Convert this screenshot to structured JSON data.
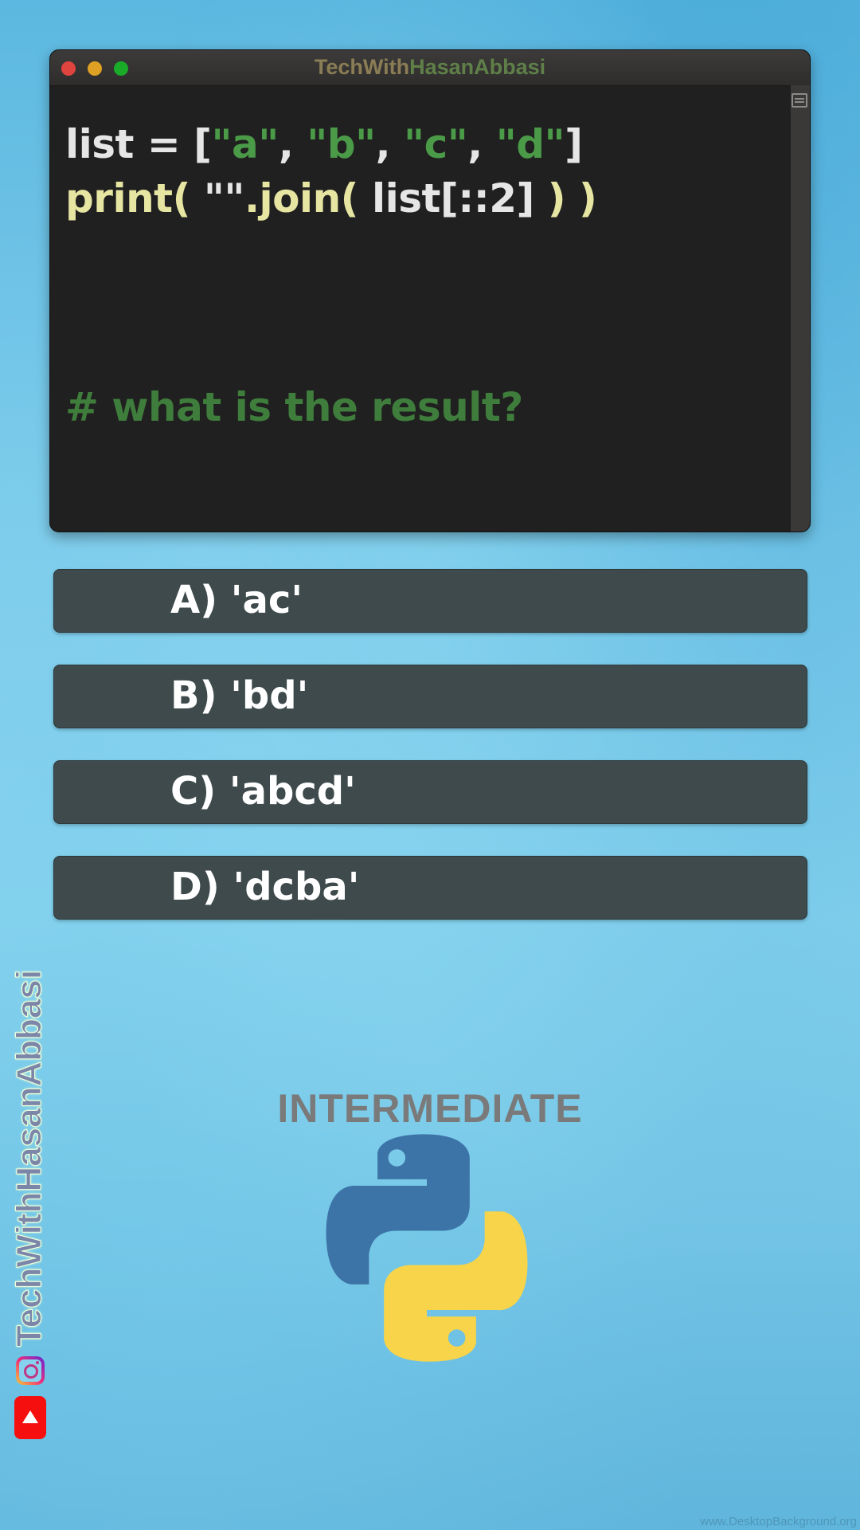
{
  "window": {
    "title_part1": "TechWith",
    "title_part2": "HasanAbbasi"
  },
  "code": {
    "line1": [
      {
        "text": "list = [",
        "color": "white"
      },
      {
        "text": "\"a\"",
        "color": "green"
      },
      {
        "text": ", ",
        "color": "white"
      },
      {
        "text": "\"b\"",
        "color": "green"
      },
      {
        "text": ", ",
        "color": "white"
      },
      {
        "text": "\"c\"",
        "color": "green"
      },
      {
        "text": ", ",
        "color": "white"
      },
      {
        "text": "\"d\"",
        "color": "green"
      },
      {
        "text": "]",
        "color": "white"
      }
    ],
    "line2": [
      {
        "text": "print( ",
        "color": "yellow"
      },
      {
        "text": "\"\"",
        "color": "white"
      },
      {
        "text": ".join( ",
        "color": "yellow"
      },
      {
        "text": "list[::2] ",
        "color": "white"
      },
      {
        "text": ") )",
        "color": "yellow"
      }
    ],
    "comment": "# what is the result?"
  },
  "options": [
    {
      "label": "A) 'ac'"
    },
    {
      "label": "B) 'bd'"
    },
    {
      "label": "C) 'abcd'"
    },
    {
      "label": "D) 'dcba'"
    }
  ],
  "level": "INTERMEDIATE",
  "branding": {
    "side_text": "TechWithHasanAbbasi",
    "icons": [
      "instagram-icon",
      "youtube-icon"
    ]
  },
  "watermark": "www.DesktopBackground.org",
  "colors": {
    "code_white": "#e6e6e6",
    "code_green": "#4a9a48",
    "code_yellow": "#e7e5a2",
    "option_bg": "#3e4a4b",
    "python_blue": "#3d74a8",
    "python_yellow": "#f7d44a"
  }
}
